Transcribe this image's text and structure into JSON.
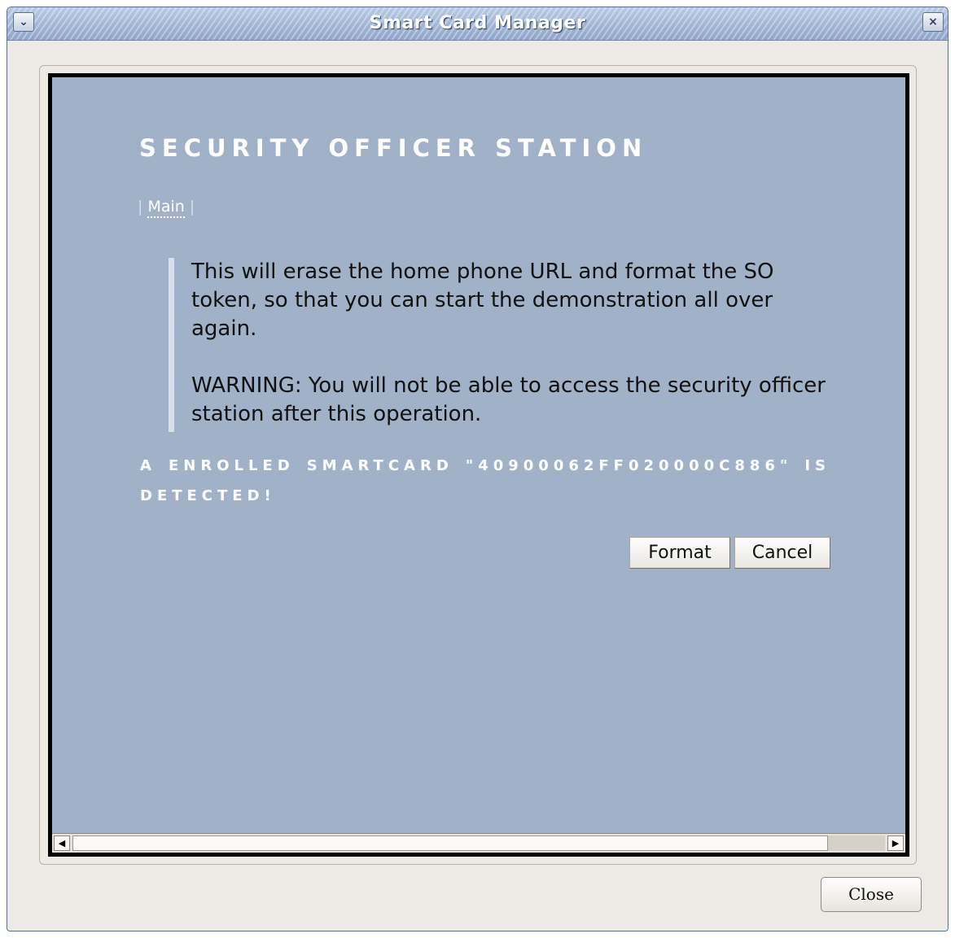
{
  "window": {
    "title": "Smart Card Manager",
    "menu_icon": "chevron-down-icon",
    "close_icon": "close-icon"
  },
  "content": {
    "heading": "SECURITY OFFICER STATION",
    "nav": {
      "separator": "|",
      "main_link": "Main"
    },
    "message": {
      "paragraph1": "This will erase the home phone URL and format the SO token, so that you can start the demonstration all over again.",
      "paragraph2": "WARNING: You will not be able to access the security officer station after this operation."
    },
    "status": "A ENROLLED SMARTCARD \"40900062FF020000C886\" IS DETECTED!",
    "format_button": "Format",
    "cancel_button": "Cancel"
  },
  "scrollbar": {
    "left_arrow": "◀",
    "right_arrow": "▶"
  },
  "footer": {
    "close_button": "Close"
  },
  "colors": {
    "page_background": "#a1b1c8",
    "window_background": "#edeae5",
    "titlebar": "#9bb0d3",
    "heading_text": "#ffffff"
  }
}
